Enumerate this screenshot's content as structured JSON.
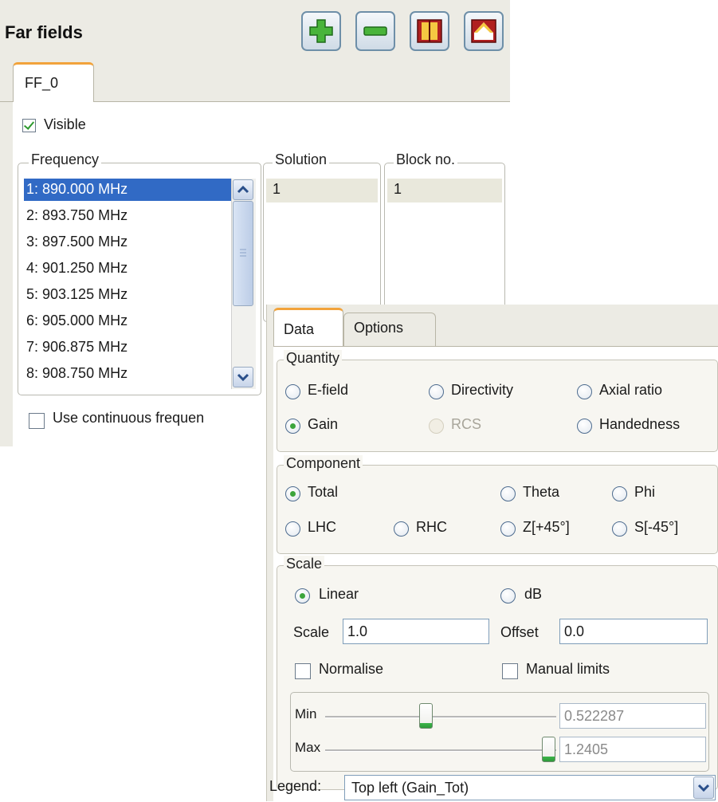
{
  "far_fields": {
    "title": "Far fields",
    "toolbar": {
      "add": "add-icon",
      "remove": "remove-icon",
      "book": "book-icon",
      "roof": "roof-icon"
    },
    "tab": "FF_0",
    "visible": {
      "label": "Visible",
      "checked": true
    },
    "frequency": {
      "legend": "Frequency",
      "items": [
        "1: 890.000 MHz",
        "2: 893.750 MHz",
        "3: 897.500 MHz",
        "4: 901.250 MHz",
        "5: 903.125 MHz",
        "6: 905.000 MHz",
        "7: 906.875 MHz",
        "8: 908.750 MHz"
      ],
      "selected_index": 0
    },
    "solution": {
      "legend": "Solution",
      "value": "1"
    },
    "block": {
      "legend": "Block no.",
      "value": "1"
    },
    "continuous": {
      "label": "Use continuous frequen",
      "checked": false
    }
  },
  "data_panel": {
    "tabs": [
      "Data",
      "Options"
    ],
    "quantity": {
      "legend": "Quantity",
      "options": [
        "E-field",
        "Directivity",
        "Axial ratio",
        "Gain",
        "RCS",
        "Handedness"
      ],
      "selected": "Gain",
      "disabled": [
        "RCS"
      ]
    },
    "component": {
      "legend": "Component",
      "options": [
        "Total",
        "Theta",
        "Phi",
        "LHC",
        "RHC",
        "Z[+45°]",
        "S[-45°]"
      ],
      "selected": "Total"
    },
    "scale": {
      "legend": "Scale",
      "options": [
        "Linear",
        "dB"
      ],
      "selected": "Linear",
      "scale_label": "Scale",
      "scale_value": "1.0",
      "offset_label": "Offset",
      "offset_value": "0.0",
      "normalise": {
        "label": "Normalise",
        "checked": false
      },
      "manual_limits": {
        "label": "Manual limits",
        "checked": false
      },
      "min": {
        "label": "Min",
        "value": "0.522287"
      },
      "max": {
        "label": "Max",
        "value": "1.2405"
      }
    },
    "legend": {
      "label": "Legend:",
      "value": "Top left (Gain_Tot)"
    }
  }
}
